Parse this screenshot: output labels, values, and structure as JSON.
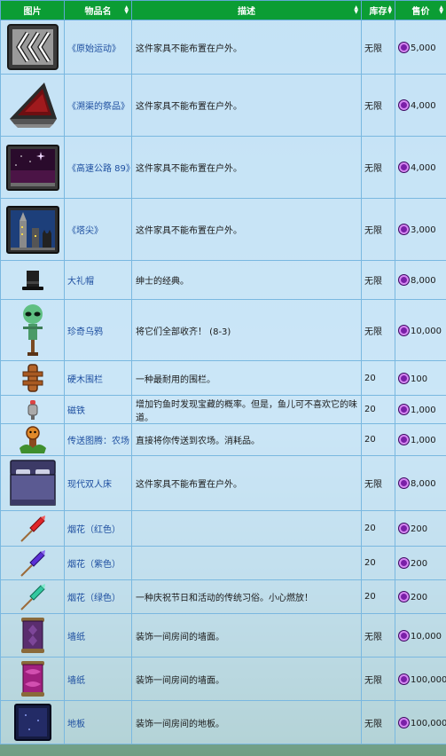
{
  "headers": {
    "image": "图片",
    "name": "物品名",
    "desc": "描述",
    "stock": "库存",
    "price": "售价"
  },
  "rows": [
    {
      "icon": "retro-arrows-painting-icon",
      "name": "《原始运动》",
      "desc": "这件家具不能布置在户外。",
      "stock": "无限",
      "price": "5,000"
    },
    {
      "icon": "red-triangle-painting-icon",
      "name": "《溯渠的祭品》",
      "desc": "这件家具不能布置在户外。",
      "stock": "无限",
      "price": "4,000"
    },
    {
      "icon": "night-sky-painting-icon",
      "name": "《高速公路 89》",
      "desc": "这件家具不能布置在户外。",
      "stock": "无限",
      "price": "4,000"
    },
    {
      "icon": "spires-painting-icon",
      "name": "《塔尖》",
      "desc": "这件家具不能布置在户外。",
      "stock": "无限",
      "price": "3,000"
    },
    {
      "icon": "top-hat-icon",
      "name": "大礼帽",
      "desc": "绅士的经典。",
      "stock": "无限",
      "price": "8,000"
    },
    {
      "icon": "alien-rarecrow-icon",
      "name": "珍奇乌鸦",
      "desc": "将它们全部收齐！ (8-3)",
      "stock": "无限",
      "price": "10,000"
    },
    {
      "icon": "hardwood-fence-icon",
      "name": "硬木围栏",
      "desc": "一种最耐用的围栏。",
      "stock": "20",
      "price": "100"
    },
    {
      "icon": "magnet-bait-icon",
      "name": "磁铁",
      "desc": "增加钓鱼时发现宝藏的概率。但是，鱼儿可不喜欢它的味道。",
      "stock": "20",
      "price": "1,000"
    },
    {
      "icon": "farm-totem-icon",
      "name": "传送图腾：农场",
      "desc": "直接将你传送到农场。消耗品。",
      "stock": "20",
      "price": "1,000"
    },
    {
      "icon": "double-bed-icon",
      "name": "现代双人床",
      "desc": "这件家具不能布置在户外。",
      "stock": "无限",
      "price": "8,000"
    },
    {
      "icon": "red-firework-icon",
      "name": "烟花（红色）",
      "desc": "",
      "stock": "20",
      "price": "200"
    },
    {
      "icon": "purple-firework-icon",
      "name": "烟花（紫色）",
      "desc": "",
      "stock": "20",
      "price": "200"
    },
    {
      "icon": "green-firework-icon",
      "name": "烟花（绿色）",
      "desc": "一种庆祝节日和活动的传统习俗。小心燃放！",
      "stock": "20",
      "price": "200"
    },
    {
      "icon": "purple-wallpaper-icon",
      "name": "墙纸",
      "desc": "装饰一间房间的墙面。",
      "stock": "无限",
      "price": "10,000"
    },
    {
      "icon": "magenta-wallpaper-icon",
      "name": "墙纸",
      "desc": "装饰一间房间的墙面。",
      "stock": "无限",
      "price": "100,000"
    },
    {
      "icon": "dark-flooring-icon",
      "name": "地板",
      "desc": "装饰一间房间的地板。",
      "stock": "无限",
      "price": "100,000"
    }
  ]
}
